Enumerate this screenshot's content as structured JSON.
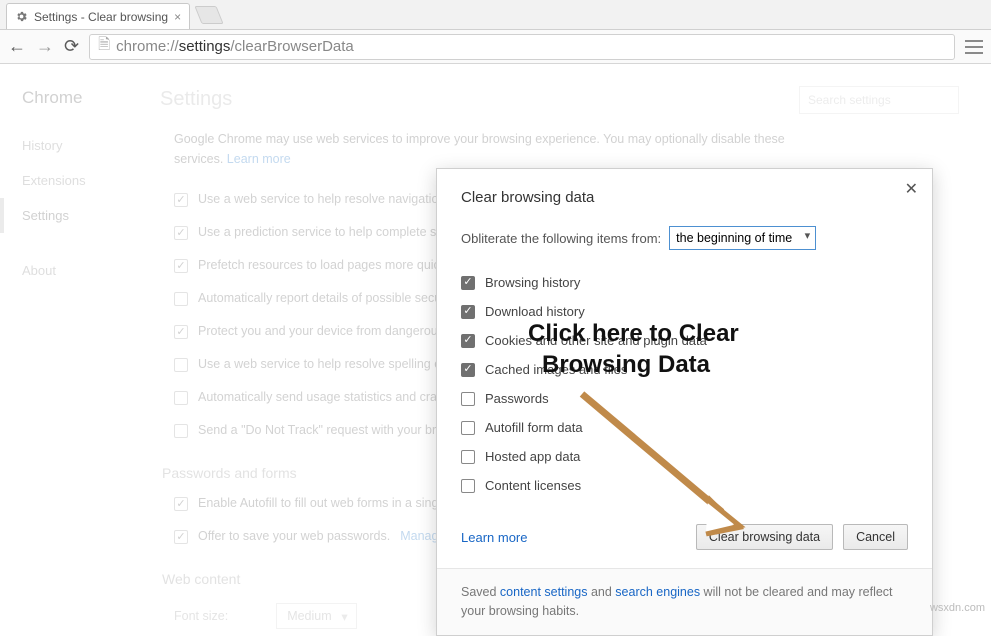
{
  "tab": {
    "title": "Settings - Clear browsing"
  },
  "omnibox": {
    "prefix": "chrome://",
    "strong": "settings",
    "rest": "/clearBrowserData"
  },
  "sidebar": {
    "title": "Chrome",
    "items": [
      "History",
      "Extensions",
      "Settings",
      "About"
    ],
    "activeIndex": 2
  },
  "content": {
    "heading": "Settings",
    "search_placeholder": "Search settings",
    "intro_a": "Google Chrome may use web services to improve your browsing experience. You may optionally disable these services. ",
    "learn_more": "Learn more",
    "privacy_opts": [
      {
        "label": "Use a web service to help resolve navigation errors",
        "checked": true
      },
      {
        "label": "Use a prediction service to help complete searches and URLs typed in the address bar or the app launcher search box",
        "checked": true
      },
      {
        "label": "Prefetch resources to load pages more quickly",
        "checked": true
      },
      {
        "label": "Automatically report details of possible security incidents to Google",
        "checked": false
      },
      {
        "label": "Protect you and your device from dangerous sites",
        "checked": true
      },
      {
        "label": "Use a web service to help resolve spelling errors",
        "checked": false
      },
      {
        "label": "Automatically send usage statistics and crash reports to Google",
        "checked": false
      },
      {
        "label": "Send a \"Do Not Track\" request with your browsing traffic",
        "checked": false
      }
    ],
    "pw_heading": "Passwords and forms",
    "pw_opts": [
      {
        "label": "Enable Autofill to fill out web forms in a single click.",
        "checked": true
      },
      {
        "label": "Offer to save your web passwords. ",
        "checked": true,
        "link": "Manage passwords"
      }
    ],
    "web_heading": "Web content",
    "font_label": "Font size:",
    "font_value": "Medium"
  },
  "dialog": {
    "title": "Clear browsing data",
    "from_label": "Obliterate the following items from:",
    "from_value": "the beginning of time",
    "opts": [
      {
        "label": "Browsing history",
        "checked": true
      },
      {
        "label": "Download history",
        "checked": true
      },
      {
        "label": "Cookies and other site and plugin data",
        "checked": true
      },
      {
        "label": "Cached images and files",
        "checked": true
      },
      {
        "label": "Passwords",
        "checked": false
      },
      {
        "label": "Autofill form data",
        "checked": false
      },
      {
        "label": "Hosted app data",
        "checked": false
      },
      {
        "label": "Content licenses",
        "checked": false
      }
    ],
    "learn_more": "Learn more",
    "primary_btn": "Clear browsing data",
    "cancel_btn": "Cancel",
    "note_a": "Saved ",
    "note_link1": "content settings",
    "note_b": " and ",
    "note_link2": "search engines",
    "note_c": " will not be cleared and may reflect your browsing habits."
  },
  "annotation": {
    "line1": "Click here to Clear",
    "line2": "Browsing Data"
  },
  "watermark": "wsxdn.com"
}
